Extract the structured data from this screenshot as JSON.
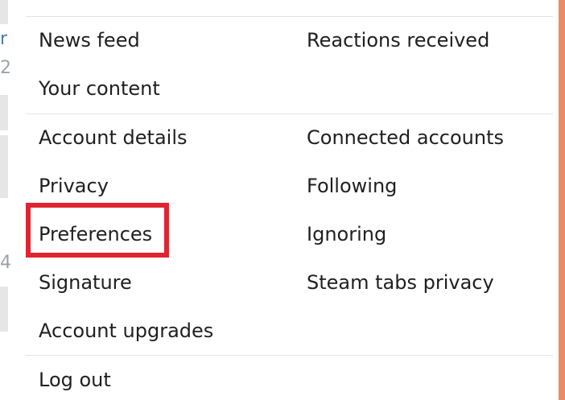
{
  "menu": {
    "section_1": {
      "left": [
        "News feed",
        "Your content"
      ],
      "right": [
        "Reactions received"
      ]
    },
    "section_2": {
      "left": [
        "Account details",
        "Privacy",
        "Preferences",
        "Signature",
        "Account upgrades"
      ],
      "right": [
        "Connected accounts",
        "Following",
        "Ignoring",
        "Steam tabs privacy"
      ]
    },
    "section_3": {
      "left": [
        "Log out"
      ]
    }
  },
  "highlight": {
    "target": "Preferences",
    "color": "#e0242f"
  },
  "colors": {
    "accent": "#ed8a66",
    "text": "#1f1f1f",
    "divider": "#e3e3e3"
  },
  "behind_page": {
    "chars": [
      "r",
      "2",
      "4"
    ]
  }
}
